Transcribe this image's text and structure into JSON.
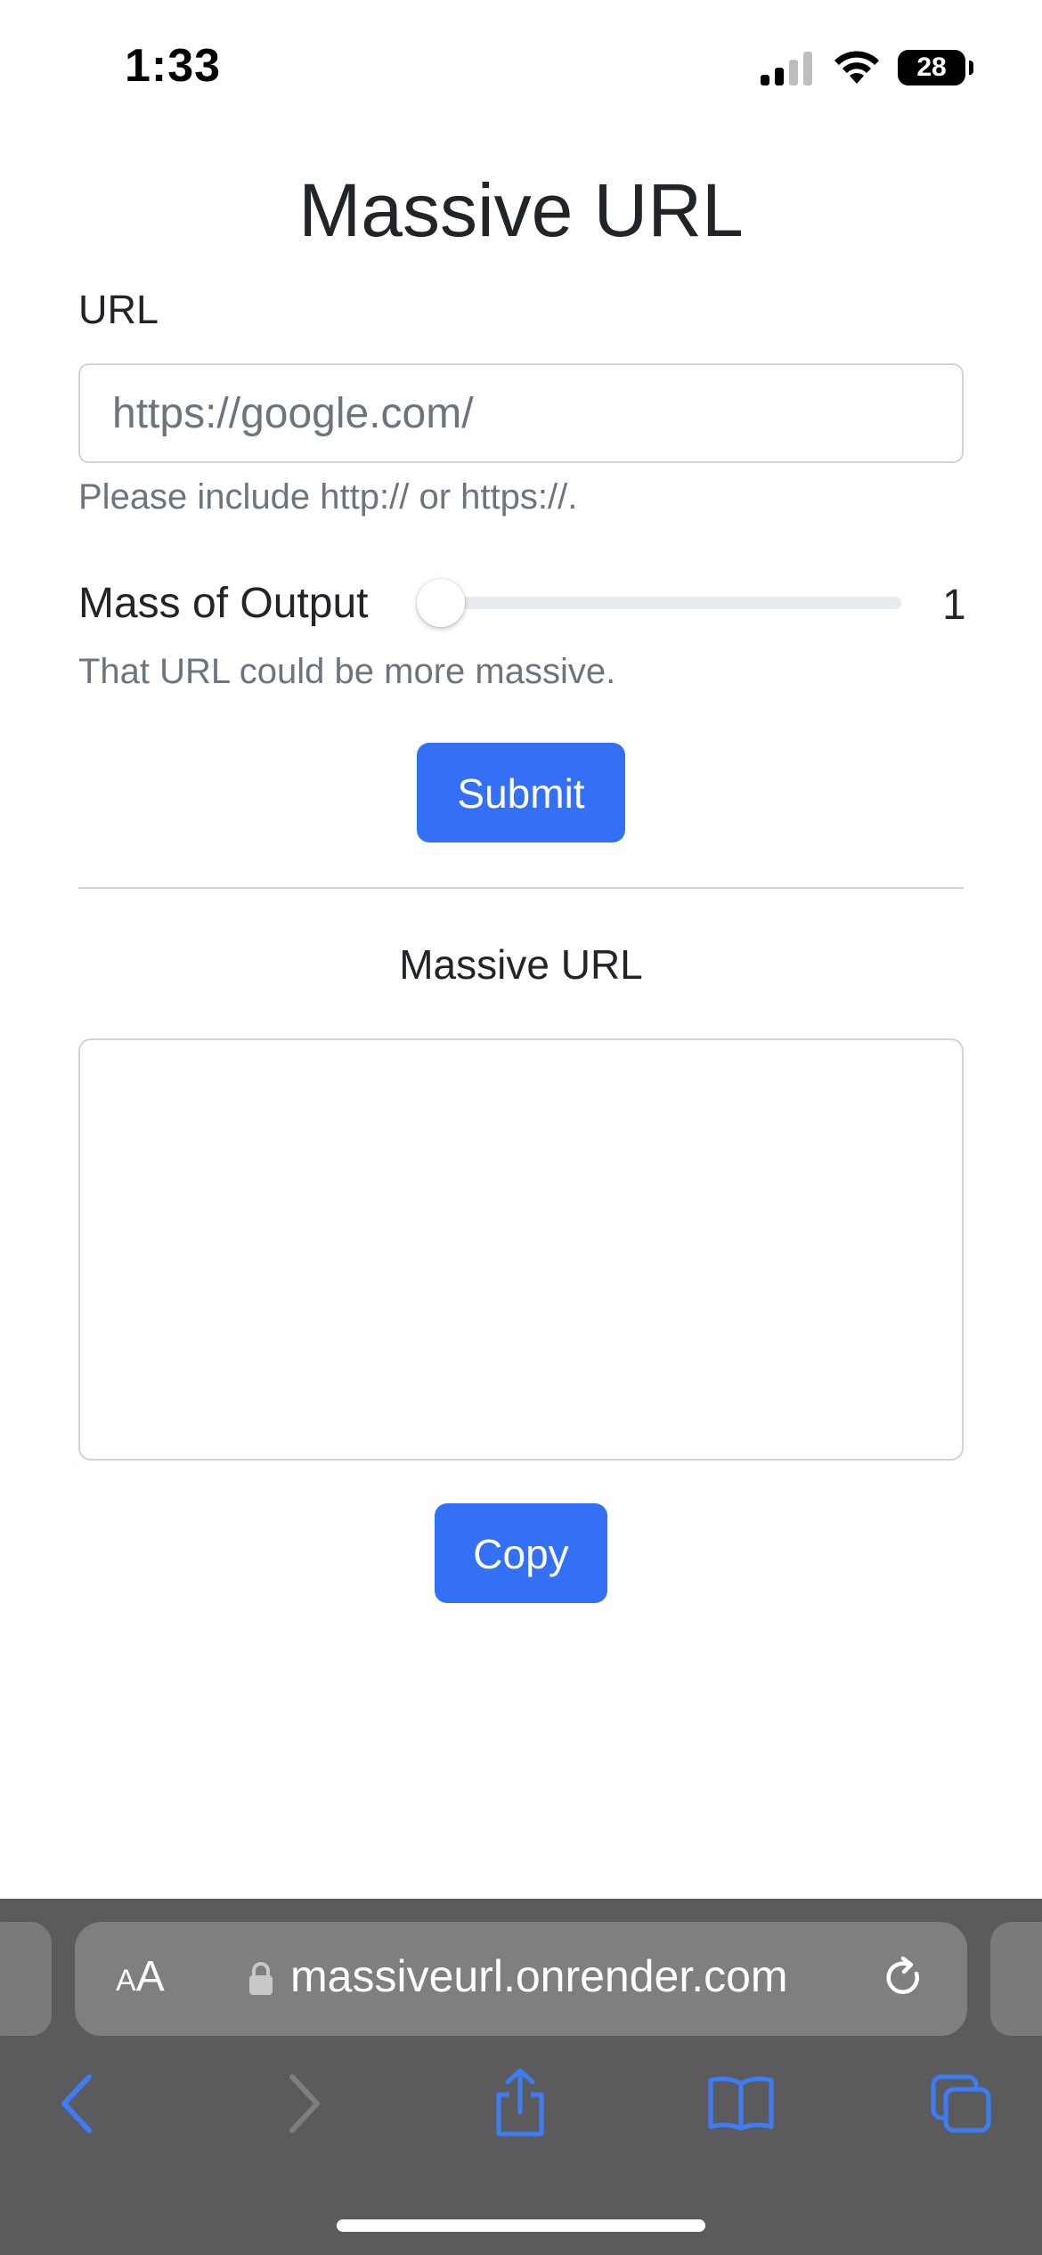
{
  "status_bar": {
    "time": "1:33",
    "battery": "28"
  },
  "page": {
    "title": "Massive URL",
    "url_label": "URL",
    "url_placeholder": "https://google.com/",
    "url_helper": "Please include http:// or https://.",
    "mass_label": "Mass of Output",
    "mass_value": "1",
    "mass_feedback": "That URL could be more massive.",
    "submit_label": "Submit",
    "output_title": "Massive URL",
    "output_value": "",
    "copy_label": "Copy"
  },
  "slider": {
    "min": 1,
    "value": 1
  },
  "browser": {
    "aa_small": "A",
    "aa_large": "A",
    "domain": "massiveurl.onrender.com",
    "icons": [
      "back-icon",
      "forward-icon",
      "share-icon",
      "bookmarks-icon",
      "tabs-icon",
      "reload-icon",
      "lock-icon"
    ]
  },
  "colors": {
    "primary_button": "#3470f6",
    "toolbar": "#5b5b5d",
    "icon_blue": "#3d7cf5",
    "muted_text": "#6c757d"
  }
}
